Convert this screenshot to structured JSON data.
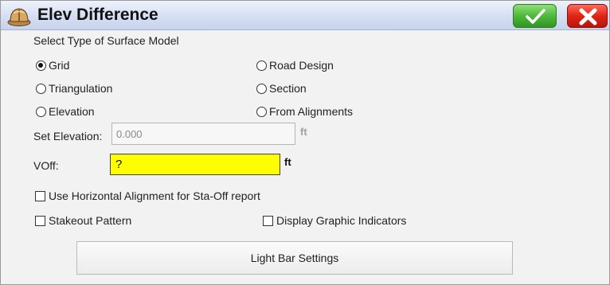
{
  "window": {
    "title": "Elev Difference",
    "app_icon": "hard-hat-icon",
    "ok_icon": "checkmark-icon",
    "cancel_icon": "x-icon"
  },
  "surface_model": {
    "heading": "Select Type of Surface Model",
    "options": [
      {
        "label": "Grid",
        "selected": true
      },
      {
        "label": "Triangulation",
        "selected": false
      },
      {
        "label": "Elevation",
        "selected": false
      },
      {
        "label": "Road Design",
        "selected": false
      },
      {
        "label": "Section",
        "selected": false
      },
      {
        "label": "From Alignments",
        "selected": false
      }
    ]
  },
  "set_elevation": {
    "label": "Set Elevation:",
    "value": "0.000",
    "unit": "ft",
    "enabled": false
  },
  "voff": {
    "label": "VOff:",
    "value": "?",
    "unit": "ft"
  },
  "checkboxes": {
    "horizontal_alignment": {
      "label": "Use Horizontal Alignment for Sta-Off report",
      "checked": false
    },
    "stakeout_pattern": {
      "label": "Stakeout Pattern",
      "checked": false
    },
    "graphic_indicators": {
      "label": "Display Graphic Indicators",
      "checked": false
    }
  },
  "buttons": {
    "light_bar": "Light Bar Settings"
  },
  "colors": {
    "voff_highlight": "#ffff00",
    "ok_green": "#4fb83a",
    "cancel_red": "#e02516",
    "titlebar": "#d5dff2"
  }
}
